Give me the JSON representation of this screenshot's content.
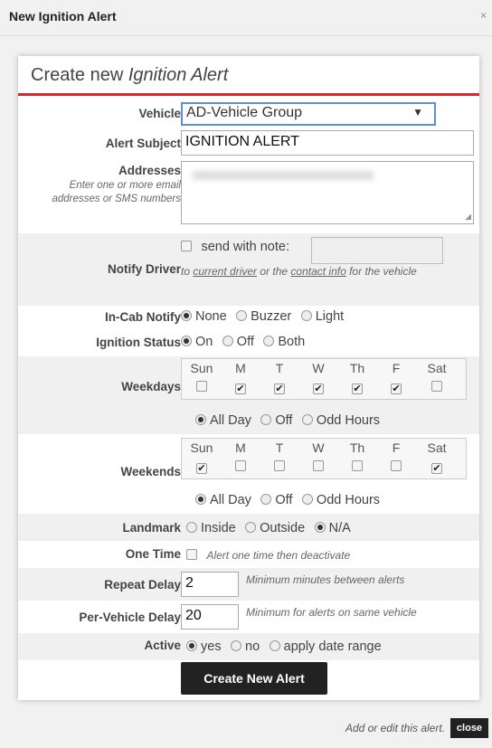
{
  "window": {
    "title": "New Ignition Alert",
    "close_glyph": "×"
  },
  "dialog": {
    "heading_prefix": "Create new ",
    "heading_italic": "Ignition Alert"
  },
  "vehicle": {
    "label": "Vehicle",
    "selected": "AD-Vehicle Group",
    "caret": "▼"
  },
  "subject": {
    "label": "Alert Subject",
    "value": "IGNITION ALERT"
  },
  "addresses": {
    "label": "Addresses",
    "hint": "Enter one or more email addresses or SMS numbers",
    "value": ""
  },
  "notify_driver": {
    "label": "Notify Driver",
    "checkbox_label": "send with note:",
    "desc_prefix": "to ",
    "link1": "current driver",
    "desc_mid": " or the ",
    "link2": "contact info",
    "desc_suffix": " for the vehicle"
  },
  "in_cab": {
    "label": "In-Cab Notify",
    "options": [
      "None",
      "Buzzer",
      "Light"
    ],
    "selected": "None"
  },
  "ignition_status": {
    "label": "Ignition Status",
    "options": [
      "On",
      "Off",
      "Both"
    ],
    "selected": "On"
  },
  "weekdays": {
    "label": "Weekdays",
    "days": [
      "Sun",
      "M",
      "T",
      "W",
      "Th",
      "F",
      "Sat"
    ],
    "checked": [
      false,
      true,
      true,
      true,
      true,
      true,
      false
    ],
    "options": [
      "All Day",
      "Off",
      "Odd Hours"
    ],
    "selected": "All Day"
  },
  "weekends": {
    "label": "Weekends",
    "days": [
      "Sun",
      "M",
      "T",
      "W",
      "Th",
      "F",
      "Sat"
    ],
    "checked": [
      true,
      false,
      false,
      false,
      false,
      false,
      true
    ],
    "options": [
      "All Day",
      "Off",
      "Odd Hours"
    ],
    "selected": "All Day"
  },
  "landmark": {
    "label": "Landmark",
    "options": [
      "Inside",
      "Outside",
      "N/A"
    ],
    "selected": "N/A"
  },
  "one_time": {
    "label": "One Time",
    "text": "Alert one time then deactivate",
    "checked": false
  },
  "repeat_delay": {
    "label": "Repeat Delay",
    "value": "2",
    "hint": "Minimum minutes between alerts"
  },
  "per_vehicle_delay": {
    "label": "Per-Vehicle Delay",
    "value": "20",
    "hint": "Minimum for alerts on same vehicle"
  },
  "active": {
    "label": "Active",
    "options": [
      "yes",
      "no",
      "apply date range"
    ],
    "selected": "yes"
  },
  "create_button": "Create New Alert",
  "footer": {
    "message": "Add or edit this alert.",
    "close_label": "close"
  },
  "colors": {
    "accent_red": "#d9262c",
    "select_border": "#5d8fd8",
    "button_bg": "#222222"
  }
}
